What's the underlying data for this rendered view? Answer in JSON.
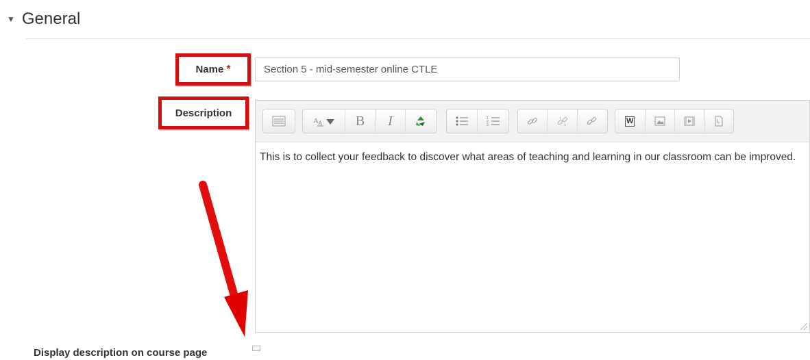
{
  "section": {
    "title": "General",
    "caret": "▼"
  },
  "name_field": {
    "label": "Name",
    "required_mark": "*",
    "value": "Section 5 - mid-semester online CTLE"
  },
  "description_field": {
    "label": "Description",
    "text": "This is to collect your feedback to discover what areas of teaching and learning in our classroom can be improved."
  },
  "toolbar": {
    "groups": [
      [
        "toolbar-toggle-icon"
      ],
      [
        "font-size-icon",
        "bold-icon",
        "italic-icon",
        "recycle-icon"
      ],
      [
        "unordered-list-icon",
        "ordered-list-icon"
      ],
      [
        "link-icon",
        "unlink-icon",
        "emoticon-link-icon"
      ],
      [
        "word-paste-icon",
        "image-icon",
        "media-icon",
        "manage-files-icon"
      ]
    ],
    "bold_glyph": "B",
    "italic_glyph": "I",
    "word_glyph": "W"
  },
  "display_description": {
    "label": "Display description on course page",
    "checked": false
  },
  "colors": {
    "highlight": "#d50f0f",
    "annotation_arrow": "#e00000"
  }
}
